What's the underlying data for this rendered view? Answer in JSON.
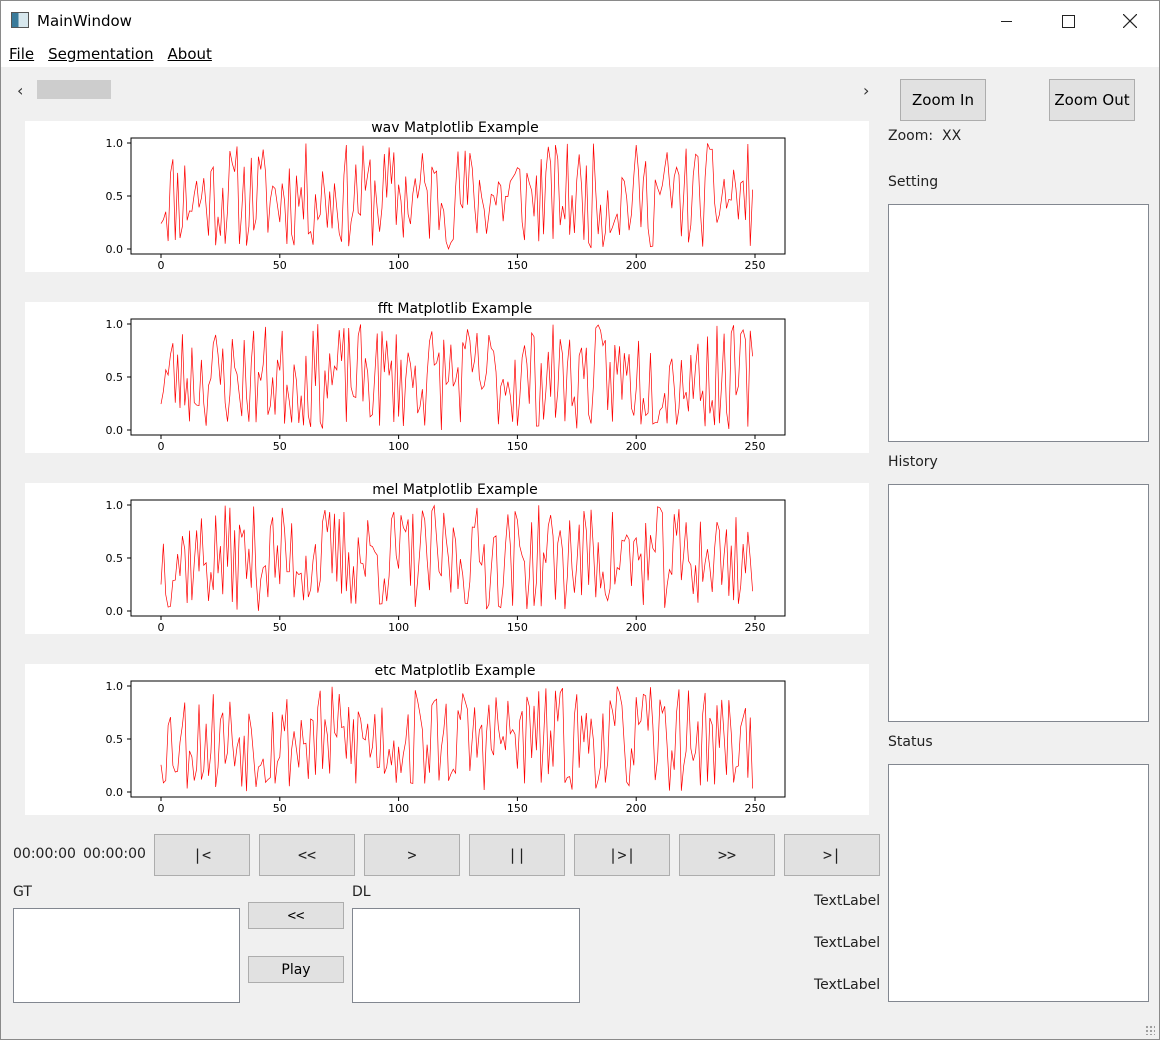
{
  "window": {
    "title": "MainWindow"
  },
  "menu": [
    "File",
    "Segmentation",
    "About"
  ],
  "plots": [
    {
      "title": "wav Matplotlib Example",
      "seed": 11
    },
    {
      "title": "fft Matplotlib Example",
      "seed": 23
    },
    {
      "title": "mel Matplotlib Example",
      "seed": 37
    },
    {
      "title": "etc Matplotlib Example",
      "seed": 53
    }
  ],
  "chart_data": {
    "type": "line",
    "color": "#ff0000",
    "xlim": [
      0,
      250
    ],
    "ylim": [
      0,
      1
    ],
    "xticks": [
      "0",
      "50",
      "100",
      "150",
      "200",
      "250"
    ],
    "yticks": [
      "0.0",
      "0.5",
      "1.0"
    ],
    "points": 250
  },
  "zoom": {
    "in_label": "Zoom In",
    "out_label": "Zoom Out",
    "zoom_text": "Zoom:  XX"
  },
  "panels": {
    "setting": "Setting",
    "history": "History",
    "status": "Status"
  },
  "playback": {
    "time_current": "00:00:00",
    "time_total": "00:00:00",
    "buttons": [
      "|<",
      "<<",
      ">",
      "||",
      "|>|",
      ">>",
      ">|"
    ]
  },
  "gt_label": "GT",
  "dl_label": "DL",
  "transfer_button": "<<",
  "play_button": "Play",
  "text_labels": [
    "TextLabel",
    "TextLabel",
    "TextLabel"
  ]
}
